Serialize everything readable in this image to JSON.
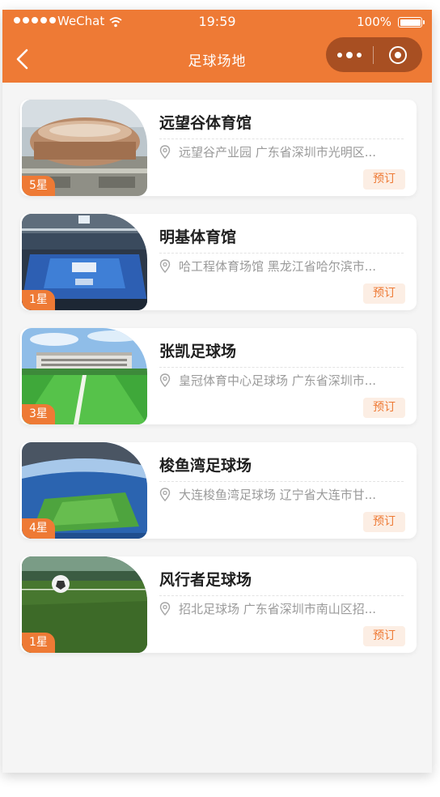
{
  "status_bar": {
    "carrier": "WeChat",
    "time": "19:59",
    "battery": "100%"
  },
  "nav": {
    "title": "足球场地"
  },
  "theme": {
    "accent": "#ee7a35",
    "capsule": "#a84f22"
  },
  "venues": [
    {
      "name": "远望谷体育馆",
      "address": "远望谷产业园 广东省深圳市光明区...",
      "stars": "5星",
      "action": "预订",
      "image": "stadium-aerial"
    },
    {
      "name": "明基体育馆",
      "address": "哈工程体育场馆 黑龙江省哈尔滨市...",
      "stars": "1星",
      "action": "预订",
      "image": "indoor-arena"
    },
    {
      "name": "张凯足球场",
      "address": "皇冠体育中心足球场 广东省深圳市...",
      "stars": "3星",
      "action": "预订",
      "image": "outdoor-pitch"
    },
    {
      "name": "梭鱼湾足球场",
      "address": "大连梭鱼湾足球场 辽宁省大连市甘...",
      "stars": "4星",
      "action": "预订",
      "image": "stadium-bowl"
    },
    {
      "name": "风行者足球场",
      "address": "招北足球场 广东省深圳市南山区招...",
      "stars": "1星",
      "action": "预订",
      "image": "turf-ball"
    }
  ]
}
